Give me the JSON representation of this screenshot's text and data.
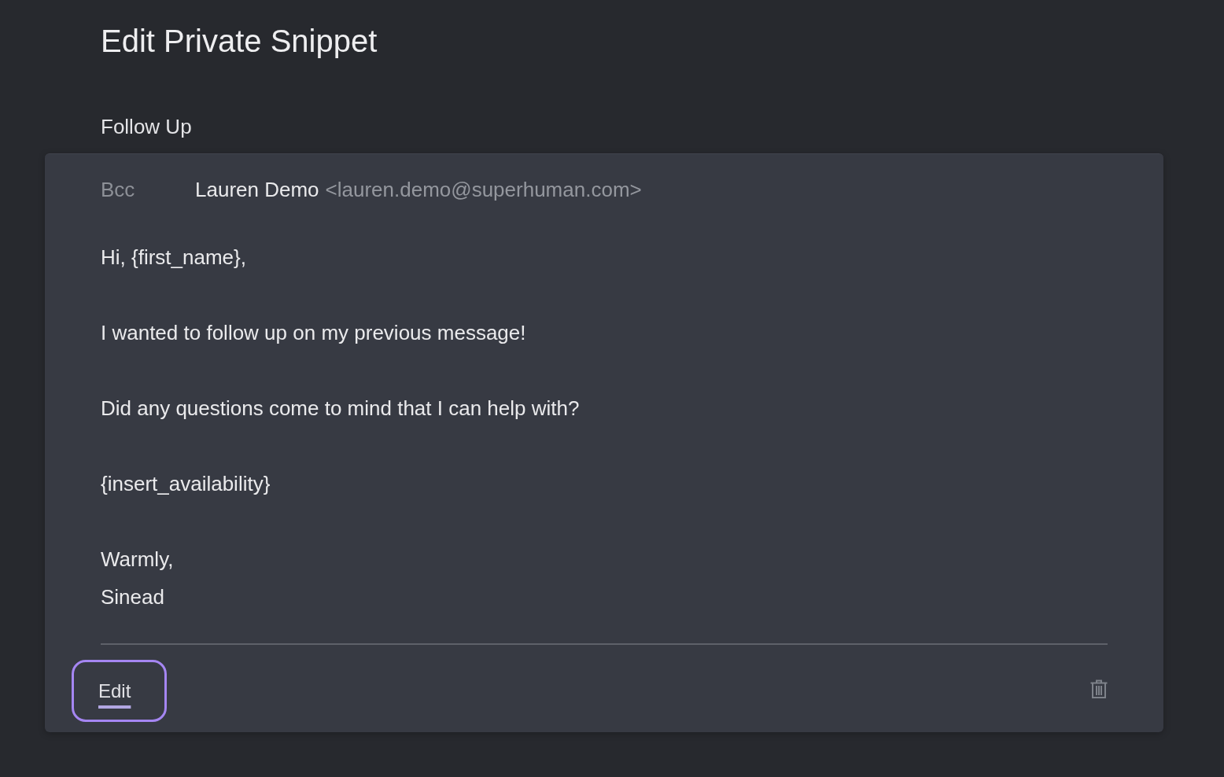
{
  "page": {
    "title": "Edit Private Snippet"
  },
  "snippet": {
    "name": "Follow Up",
    "recipient": {
      "field_label": "Bcc",
      "name": "Lauren Demo",
      "email": "<lauren.demo@superhuman.com>"
    },
    "paragraphs": [
      [
        "Hi, {first_name},"
      ],
      [
        "I wanted to follow up on my previous message!"
      ],
      [
        "Did any questions come to mind that I can help with?"
      ],
      [
        "{insert_availability}"
      ],
      [
        "Warmly,",
        "Sinead"
      ]
    ],
    "edit_button": {
      "label": "Edit",
      "focused": true
    }
  }
}
